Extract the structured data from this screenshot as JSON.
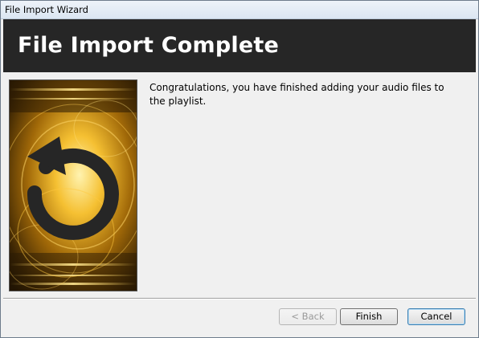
{
  "window": {
    "title": "File Import Wizard"
  },
  "header": {
    "heading": "File Import Complete"
  },
  "content": {
    "message": "Congratulations, you have finished adding your audio files to the playlist.",
    "artwork_icon": "refresh-arrow-icon"
  },
  "buttons": {
    "back": "< Back",
    "finish": "Finish",
    "cancel": "Cancel"
  },
  "colors": {
    "header_bg": "#262626",
    "header_text": "#ffffff",
    "art_glow": "#f0b020"
  }
}
